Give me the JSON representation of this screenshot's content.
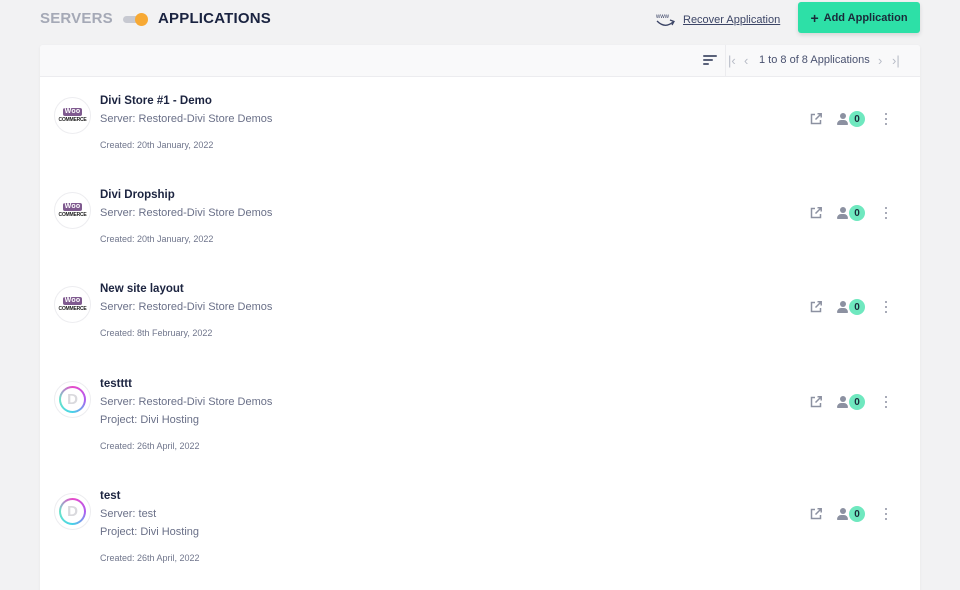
{
  "header": {
    "tab_servers": "SERVERS",
    "tab_applications": "APPLICATIONS",
    "toggle_state": "applications",
    "recover_label": "Recover Application",
    "recover_icon": "www-icon",
    "add_label": "Add Application",
    "add_icon": "plus-icon"
  },
  "colors": {
    "accent": "#2de0a7",
    "toggle_knob": "#f7a934",
    "badge": "#6fe8bf",
    "woo_purple": "#7f5a8f"
  },
  "pagination": {
    "text": "1 to 8 of 8 Applications",
    "first_icon": "first-page-icon",
    "prev_icon": "chevron-left-icon",
    "next_icon": "chevron-right-icon",
    "last_icon": "last-page-icon",
    "sort_icon": "sort-icon"
  },
  "applications": [
    {
      "name": "Divi Store #1 - Demo",
      "server": "Server: Restored-Divi Store Demos",
      "project": null,
      "created": "Created: 20th January, 2022",
      "logo": "woocommerce",
      "logo_top": "Woo",
      "logo_bottom": "COMMERCE",
      "collaborators": "0"
    },
    {
      "name": "Divi Dropship",
      "server": "Server: Restored-Divi Store Demos",
      "project": null,
      "created": "Created: 20th January, 2022",
      "logo": "woocommerce",
      "logo_top": "Woo",
      "logo_bottom": "COMMERCE",
      "collaborators": "0"
    },
    {
      "name": "New site layout",
      "server": "Server: Restored-Divi Store Demos",
      "project": null,
      "created": "Created: 8th February, 2022",
      "logo": "woocommerce",
      "logo_top": "Woo",
      "logo_bottom": "COMMERCE",
      "collaborators": "0"
    },
    {
      "name": "testttt",
      "server": "Server: Restored-Divi Store Demos",
      "project": "Project: Divi Hosting",
      "created": "Created: 26th April, 2022",
      "logo": "divi",
      "logo_letter": "D",
      "collaborators": "0"
    },
    {
      "name": "test",
      "server": "Server: test",
      "project": "Project: Divi Hosting",
      "created": "Created: 26th April, 2022",
      "logo": "divi",
      "logo_letter": "D",
      "collaborators": "0"
    }
  ]
}
